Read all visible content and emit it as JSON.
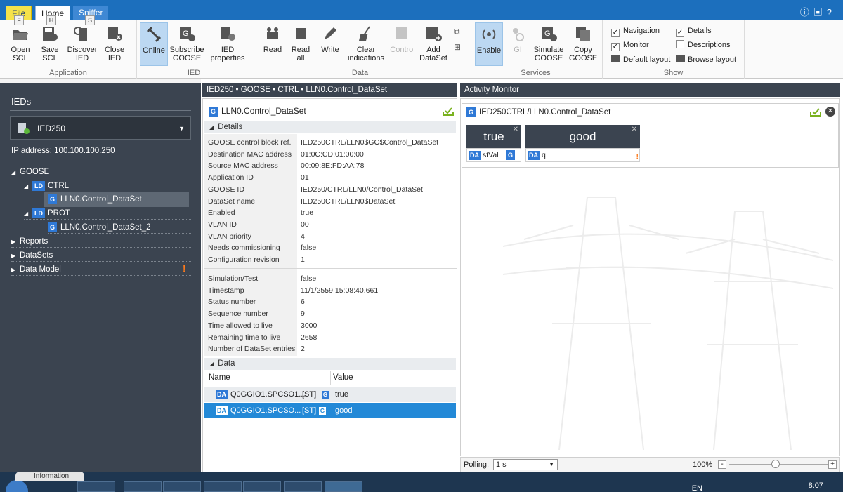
{
  "tabs": {
    "file": "File",
    "home": "Home",
    "sniffer": "Sniffer"
  },
  "keytips": {
    "file": "F",
    "home": "H",
    "sniffer": "S"
  },
  "ribbon": {
    "application": {
      "label": "Application",
      "open": "Open\nSCL",
      "save": "Save\nSCL",
      "discover": "Discover\nIED",
      "close": "Close\nIED"
    },
    "ied": {
      "label": "IED",
      "online": "Online",
      "subscribe": "Subscribe\nGOOSE",
      "properties": "IED\nproperties"
    },
    "data": {
      "label": "Data",
      "read": "Read",
      "read_all": "Read\nall",
      "write": "Write",
      "clear": "Clear\nindications",
      "control": "Control",
      "add": "Add\nDataSet"
    },
    "services": {
      "label": "Services",
      "enable": "Enable",
      "gi": "GI",
      "simulate": "Simulate\nGOOSE",
      "copy": "Copy\nGOOSE"
    },
    "show": {
      "label": "Show",
      "navigation": "Navigation",
      "details": "Details",
      "monitor": "Monitor",
      "descriptions": "Descriptions",
      "default_layout": "Default layout",
      "browse_layout": "Browse layout"
    }
  },
  "left": {
    "title": "IEDs",
    "ied_selected": "IED250",
    "ip_line": "IP address: 100.100.100.250",
    "tree": {
      "goose": "GOOSE",
      "ctrl_ld": "LD",
      "ctrl": "CTRL",
      "ctrl_ds": "LLN0.Control_DataSet",
      "prot_ld": "LD",
      "prot": "PROT",
      "prot_ds": "LLN0.Control_DataSet_2",
      "reports": "Reports",
      "datasets": "DataSets",
      "data_model": "Data Model",
      "g": "G",
      "warn": "!"
    }
  },
  "center": {
    "header": "IED250 • GOOSE • CTRL • LLN0.Control_DataSet",
    "title": "LLN0.Control_DataSet",
    "details_section": "Details",
    "data_section": "Data",
    "properties_a": [
      [
        "GOOSE control block ref.",
        "IED250CTRL/LLN0$GO$Control_DataSet"
      ],
      [
        "Destination MAC address",
        "01:0C:CD:01:00:00"
      ],
      [
        "Source MAC address",
        "00:09:8E:FD:AA:78"
      ],
      [
        "Application ID",
        "01"
      ],
      [
        "GOOSE ID",
        "IED250/CTRL/LLN0/Control_DataSet"
      ],
      [
        "DataSet name",
        "IED250CTRL/LLN0$DataSet"
      ],
      [
        "Enabled",
        "true"
      ],
      [
        "VLAN ID",
        "00"
      ],
      [
        "VLAN priority",
        "4"
      ],
      [
        "Needs commissioning",
        "false"
      ],
      [
        "Configuration revision",
        "1"
      ]
    ],
    "properties_b": [
      [
        "Simulation/Test",
        "false"
      ],
      [
        "Timestamp",
        "11/1/2559 15:08:40.661"
      ],
      [
        "Status number",
        "6"
      ],
      [
        "Sequence number",
        "9"
      ],
      [
        "Time allowed to live",
        "3000"
      ],
      [
        "Remaining time to live",
        "2658"
      ],
      [
        "Number of DataSet entries",
        "2"
      ]
    ],
    "grid_headers": {
      "name": "Name",
      "value": "Value"
    },
    "grid_rows": [
      {
        "name": "Q0GGIO1.SPCSO1....",
        "fc": "[ST]",
        "value": "true"
      },
      {
        "name": "Q0GGIO1.SPCSO...",
        "fc": "[ST]",
        "value": "good"
      }
    ]
  },
  "right": {
    "header": "Activity Monitor",
    "card_title": "IED250CTRL/LLN0.Control_DataSet",
    "tiles": [
      {
        "value": "true",
        "name": "stVal"
      },
      {
        "value": "good",
        "name": "q"
      }
    ],
    "polling_label": "Polling:",
    "polling_value": "1 s",
    "zoom": "100%"
  },
  "taskbar": {
    "info_tab": "Information",
    "lang": "EN",
    "time": "8:07"
  },
  "colors": {
    "accent": "#1c6fbd",
    "panel": "#3b4450",
    "selection": "#2389d7",
    "badge": "#2f79d6",
    "warn": "#ff7a1a"
  },
  "icons": [
    "folder-open-icon",
    "save-icon",
    "discover-icon",
    "close-ied-icon",
    "online-plug-icon",
    "goose-subscribe-icon",
    "properties-icon",
    "read-icon",
    "read-all-icon",
    "pencil-icon",
    "broom-icon",
    "control-icon",
    "add-dataset-icon",
    "broadcast-icon",
    "gi-icon",
    "simulate-icon",
    "copy-icon",
    "info-icon",
    "help-icon"
  ]
}
